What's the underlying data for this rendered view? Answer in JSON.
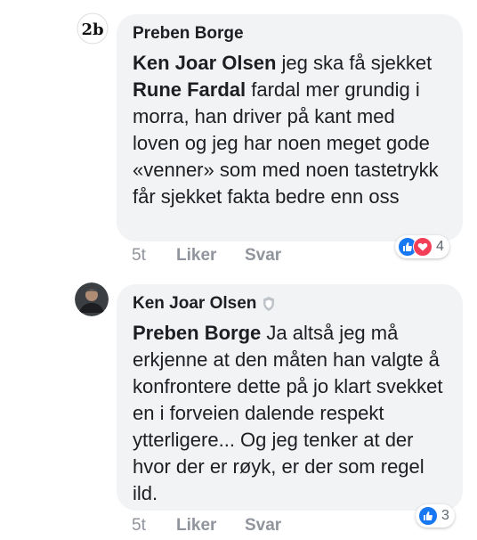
{
  "comments": [
    {
      "author": "Preben Borge",
      "avatar_text": "2b",
      "mention": "Ken Joar Olsen",
      "text_part1": "  jeg ska få sjekket ",
      "inline_mention": "Rune Fardal",
      "text_part2": " fardal mer grundig i morra, han driver på kant med loven og jeg har noen meget gode «venner» som med noen tastetrykk får sjekket fakta bedre enn oss",
      "time": "5t",
      "like_label": "Liker",
      "reply_label": "Svar",
      "reaction_count": "4",
      "reactions": [
        "like-icon",
        "love-icon"
      ]
    },
    {
      "author": "Ken Joar Olsen",
      "badge": "shield-icon",
      "mention": "Preben Borge",
      "text": " Ja altså jeg må erkjenne at den måten han valgte å konfrontere dette på jo klart svekket en i forveien dalende respekt ytterligere... Og jeg tenker at der hvor der er røyk, er der som regel ild.",
      "time": "5t",
      "like_label": "Liker",
      "reply_label": "Svar",
      "reaction_count": "3",
      "reactions": [
        "like-icon"
      ]
    }
  ],
  "colors": {
    "bubble": "#f2f3f5",
    "meta": "#90949c",
    "like": "#1877f2",
    "love": "#f33e58"
  }
}
